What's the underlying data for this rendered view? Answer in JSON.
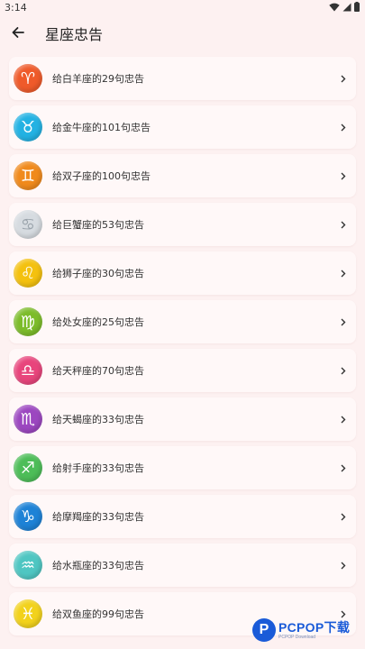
{
  "status": {
    "time": "3:14"
  },
  "app_bar": {
    "title": "星座忠告"
  },
  "items": [
    {
      "label": "给白羊座的29句忠告",
      "symbol": "♈",
      "icon": "aries-icon",
      "color": "#ef5a2a"
    },
    {
      "label": "给金牛座的101句忠告",
      "symbol": "♉",
      "icon": "taurus-icon",
      "color": "#23b2e3"
    },
    {
      "label": "给双子座的100句忠告",
      "symbol": "♊",
      "icon": "gemini-icon",
      "color": "#f08a1c"
    },
    {
      "label": "给巨蟹座的53句忠告",
      "symbol": "♋",
      "icon": "cancer-icon",
      "color": "#d6dbe0"
    },
    {
      "label": "给狮子座的30句忠告",
      "symbol": "♌",
      "icon": "leo-icon",
      "color": "#f4c10f"
    },
    {
      "label": "给处女座的25句忠告",
      "symbol": "♍",
      "icon": "virgo-icon",
      "color": "#7cbc2a"
    },
    {
      "label": "给天秤座的70句忠告",
      "symbol": "♎",
      "icon": "libra-icon",
      "color": "#e8457c"
    },
    {
      "label": "给天蝎座的33句忠告",
      "symbol": "♏",
      "icon": "scorpio-icon",
      "color": "#9c47c0"
    },
    {
      "label": "给射手座的33句忠告",
      "symbol": "♐",
      "icon": "sagittarius-icon",
      "color": "#4dbd58"
    },
    {
      "label": "给摩羯座的33句忠告",
      "symbol": "♑",
      "icon": "capricorn-icon",
      "color": "#1e82d6"
    },
    {
      "label": "给水瓶座的33句忠告",
      "symbol": "♒",
      "icon": "aquarius-icon",
      "color": "#4fc6c2"
    },
    {
      "label": "给双鱼座的99句忠告",
      "symbol": "♓",
      "icon": "pisces-icon",
      "color": "#f2d21c"
    }
  ],
  "watermark": {
    "text": "PCPOP下载",
    "sub": "PCPOP Download",
    "logo": "P"
  }
}
